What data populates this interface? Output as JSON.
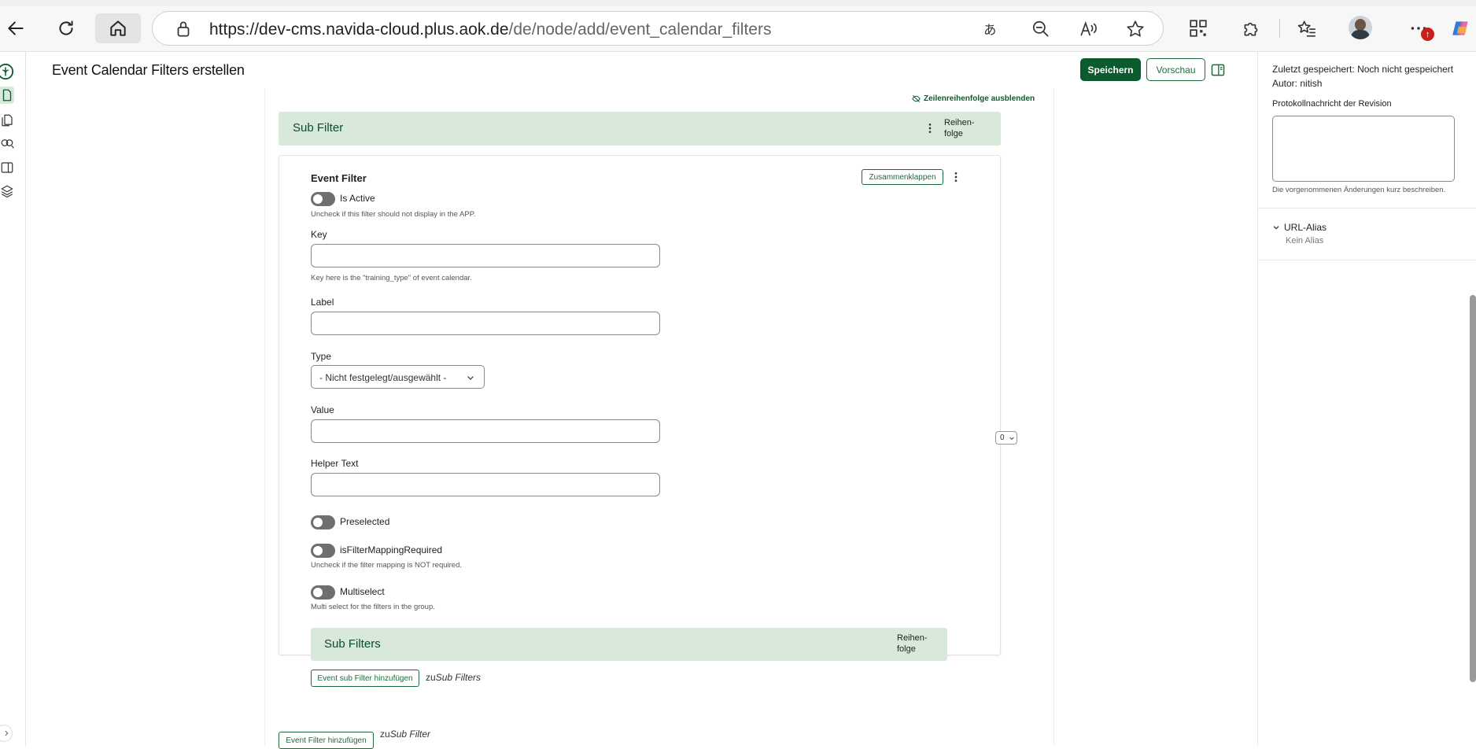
{
  "browser": {
    "url_host": "https://dev-cms.navida-cloud.plus.aok.de",
    "url_path": "/de/node/add/event_calendar_filters",
    "notification_badge": "↑"
  },
  "header": {
    "title": "Event Calendar Filters erstellen",
    "save_label": "Speichern",
    "preview_label": "Vorschau"
  },
  "main": {
    "hide_row_order_link": "Zeilenreihenfolge ausblenden",
    "sub_filter_title": "Sub Filter",
    "order_label_line1": "Reihen-",
    "order_label_line2": "folge",
    "event_filter": {
      "title": "Event Filter",
      "collapse_label": "Zusammenklappen",
      "is_active_label": "Is Active",
      "is_active_help": "Uncheck if this filter should not display in the APP.",
      "key_label": "Key",
      "key_value": "",
      "key_help": "Key here is the \"training_type\" of event calendar.",
      "label_label": "Label",
      "label_value": "",
      "type_label": "Type",
      "type_selected": "- Nicht festgelegt/ausgewählt -",
      "value_label": "Value",
      "value_value": "",
      "weight_selected": "0",
      "helper_text_label": "Helper Text",
      "helper_text_value": "",
      "preselected_label": "Preselected",
      "filter_mapping_label": "isFilterMappingRequired",
      "filter_mapping_help": "Uncheck if the filter mapping is NOT required.",
      "multiselect_label": "Multiselect",
      "multiselect_help": "Multi select for the filters in the group.",
      "sub_filters_title": "Sub Filters",
      "add_sub_filter_label": "Event sub Filter hinzufügen",
      "add_sub_filter_suffix_zu": "zu",
      "add_sub_filter_suffix_target": "Sub Filters"
    },
    "add_event_filter_label": "Event Filter hinzufügen",
    "add_event_filter_suffix_zu": "zu",
    "add_event_filter_suffix_target": "Sub Filter"
  },
  "sidebar": {
    "last_saved_label": "Zuletzt gespeichert:",
    "last_saved_value": "Noch nicht gespeichert",
    "author_label": "Autor:",
    "author_value": "nitish",
    "revision_label": "Protokollnachricht der Revision",
    "revision_value": "",
    "revision_help": "Die vorgenommenen Änderungen kurz beschreiben.",
    "url_alias_label": "URL-Alias",
    "url_alias_value": "Kein Alias"
  },
  "colors": {
    "brand_green": "#0c5b2e",
    "panel_green": "#d8e9db"
  }
}
